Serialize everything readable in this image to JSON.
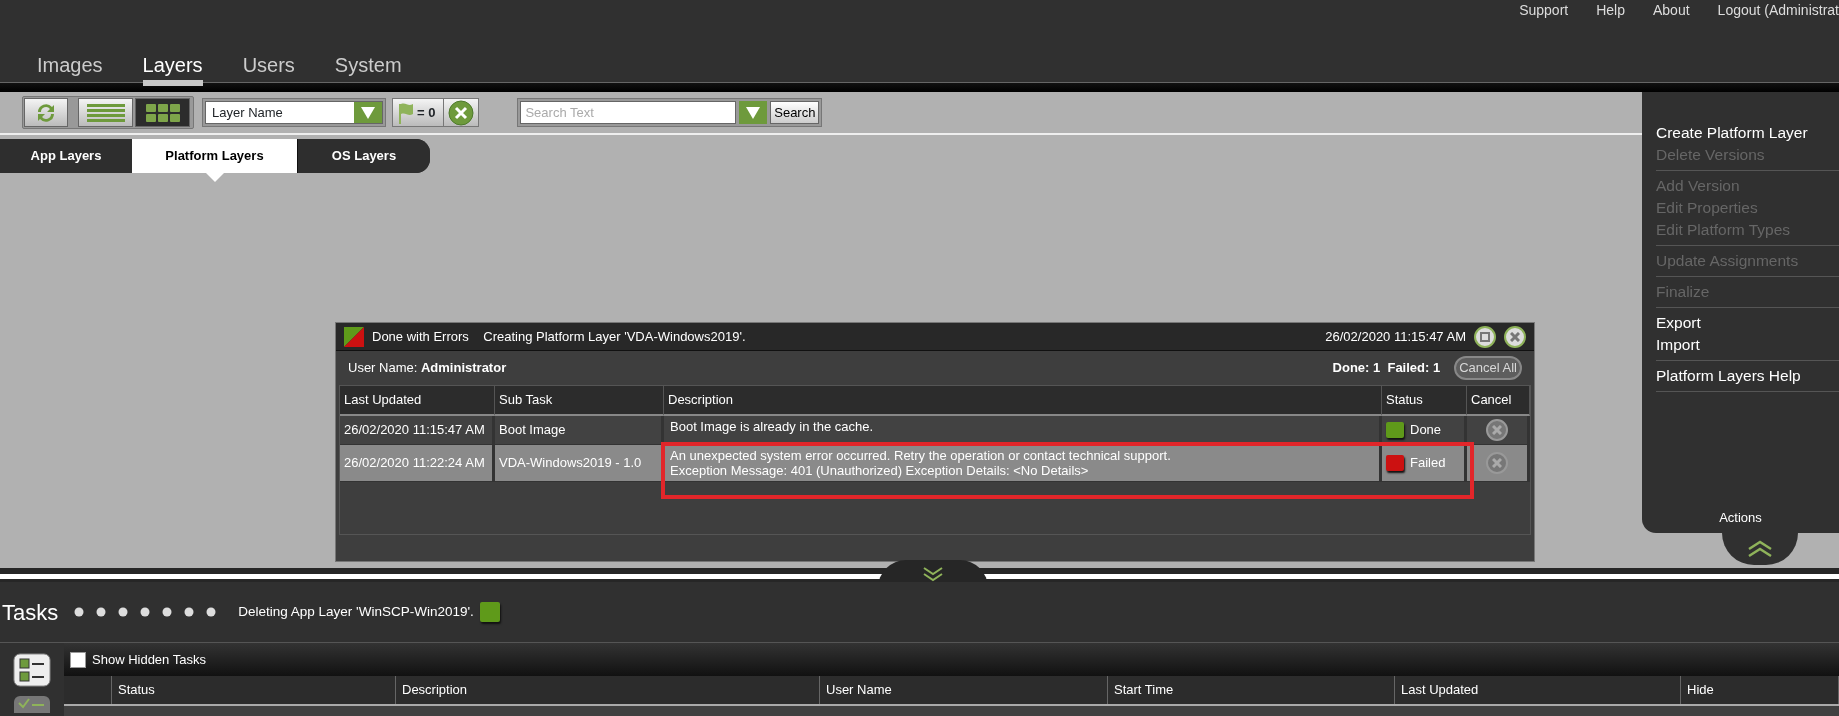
{
  "header_links": [
    "Support",
    "Help",
    "About",
    "Logout (Administrat"
  ],
  "main_tabs": [
    {
      "label": "Images",
      "selected": false
    },
    {
      "label": "Layers",
      "selected": true
    },
    {
      "label": "Users",
      "selected": false
    },
    {
      "label": "System",
      "selected": false
    }
  ],
  "toolbar": {
    "view_buttons": [
      {
        "kind": "refresh",
        "selected": false
      },
      {
        "kind": "list",
        "selected": false
      },
      {
        "kind": "grid",
        "selected": true
      }
    ],
    "filter_select": "Layer Name",
    "flag_count": "= 0",
    "search": {
      "placeholder": "Search Text",
      "button": "Search"
    }
  },
  "sub_tabs": [
    {
      "label": "App Layers",
      "selected": false
    },
    {
      "label": "Platform Layers",
      "selected": true
    },
    {
      "label": "OS Layers",
      "selected": false
    }
  ],
  "actions_panel": {
    "groups": [
      [
        {
          "label": "Create Platform Layer",
          "disabled": false
        },
        {
          "label": "Delete Versions",
          "disabled": true
        }
      ],
      [
        {
          "label": "Add Version",
          "disabled": true
        },
        {
          "label": "Edit Properties",
          "disabled": true
        },
        {
          "label": "Edit Platform Types",
          "disabled": true
        }
      ],
      [
        {
          "label": "Update Assignments",
          "disabled": true
        }
      ],
      [
        {
          "label": "Finalize",
          "disabled": true
        }
      ],
      [
        {
          "label": "Export",
          "disabled": false
        },
        {
          "label": "Import",
          "disabled": false
        }
      ],
      [
        {
          "label": "Platform Layers Help",
          "disabled": false
        }
      ]
    ],
    "label": "Actions"
  },
  "task_dialog": {
    "status_text": "Done with Errors",
    "title": "Creating Platform Layer 'VDA-Windows2019'.",
    "timestamp": "26/02/2020 11:15:47 AM",
    "user_name_label": "User Name:",
    "user_name": "Administrator",
    "done_label": "Done:",
    "done_count": "1",
    "failed_label": "Failed:",
    "failed_count": "1",
    "cancel_all": "Cancel All",
    "cancel_all_disabled": true,
    "columns": [
      "Last Updated",
      "Sub Task",
      "Description",
      "Status",
      "Cancel"
    ],
    "rows": [
      {
        "last_updated": "26/02/2020 11:15:47 AM",
        "sub_task": "Boot Image",
        "description": [
          "Boot Image is already in the cache."
        ],
        "status": "Done",
        "color": "#5f9a1a",
        "selected": false,
        "outlined": false
      },
      {
        "last_updated": "26/02/2020 11:22:24 AM",
        "sub_task": "VDA-Windows2019 - 1.0",
        "description": [
          "An unexpected system error occurred.  Retry the operation or contact technical support.",
          "Exception Message: 401 (Unauthorized) Exception Details: <No Details>"
        ],
        "status": "Failed",
        "color": "#cc1111",
        "selected": true,
        "outlined": true
      }
    ]
  },
  "tasks": {
    "title": "Tasks",
    "current_task": {
      "label": "Deleting App Layer 'WinSCP-Win2019'.",
      "color": "#5f9a1a"
    },
    "show_hidden": {
      "label": "Show Hidden Tasks",
      "checked": false
    },
    "columns": [
      "Status",
      "Description",
      "User Name",
      "Start Time",
      "Last Updated",
      "Hide"
    ]
  }
}
